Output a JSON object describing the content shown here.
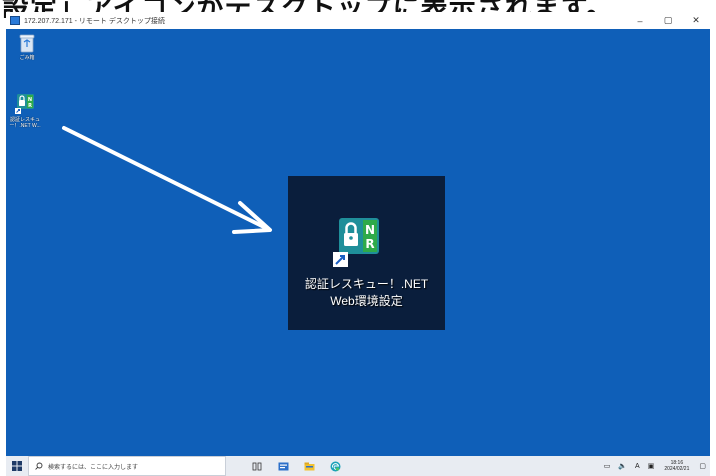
{
  "caption": {
    "text": "設定」アイコンがデスクトップに表示されます。"
  },
  "window": {
    "title": "172.207.72.171 - リモート デスクトップ接続",
    "minimize": "–",
    "restore": "▢",
    "close": "✕"
  },
  "desktop": {
    "icons": [
      {
        "label_lines": [
          "ごみ箱"
        ]
      },
      {
        "label_lines": [
          "認証レスキュ",
          "ー！.NET W..."
        ]
      }
    ],
    "callout": {
      "label_lines": [
        "認証レスキュー！.NET",
        "Web環境設定"
      ]
    }
  },
  "taskbar": {
    "search_placeholder": "検索するには、ここに入力します",
    "tray": {
      "lang": "A",
      "time": "18:16",
      "date": "2024/02/21"
    }
  },
  "colors": {
    "desktop": "#0f5fb8",
    "callout_bg": "#0a1e3c",
    "app_icon_teal": "#1f8f9a",
    "app_icon_green": "#2faa4a",
    "arrow": "#ffffff"
  }
}
